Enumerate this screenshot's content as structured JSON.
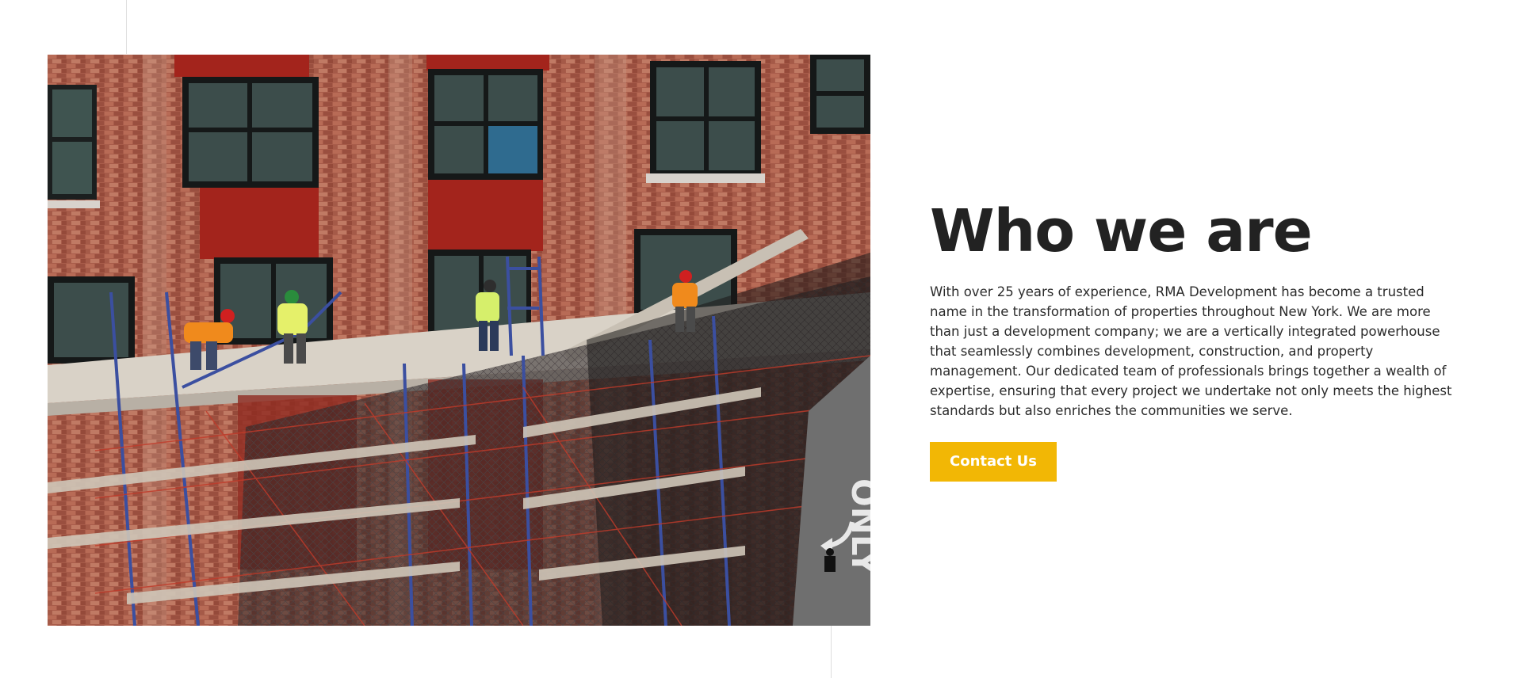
{
  "section": {
    "title": "Who we are",
    "body": "With over 25 years of experience, RMA Development has become a trusted name in the transformation of properties throughout New York. We are more than just a development company; we are a vertically integrated powerhouse that seamlessly combines development, construction, and property management. Our dedicated team of professionals brings together a wealth of expertise, ensuring that every project we undertake not only meets the highest standards but also enriches the communities we serve.",
    "cta_label": "Contact Us"
  },
  "image": {
    "alt": "Construction workers on scaffolding along a brick building facade",
    "road_marking": "ONLY"
  },
  "colors": {
    "accent": "#f2b705",
    "title": "#222222",
    "body": "#2b2b2b",
    "brick": "#a85c4a",
    "red_panel": "#a3241c",
    "scaffold": "#3b4fa0"
  }
}
